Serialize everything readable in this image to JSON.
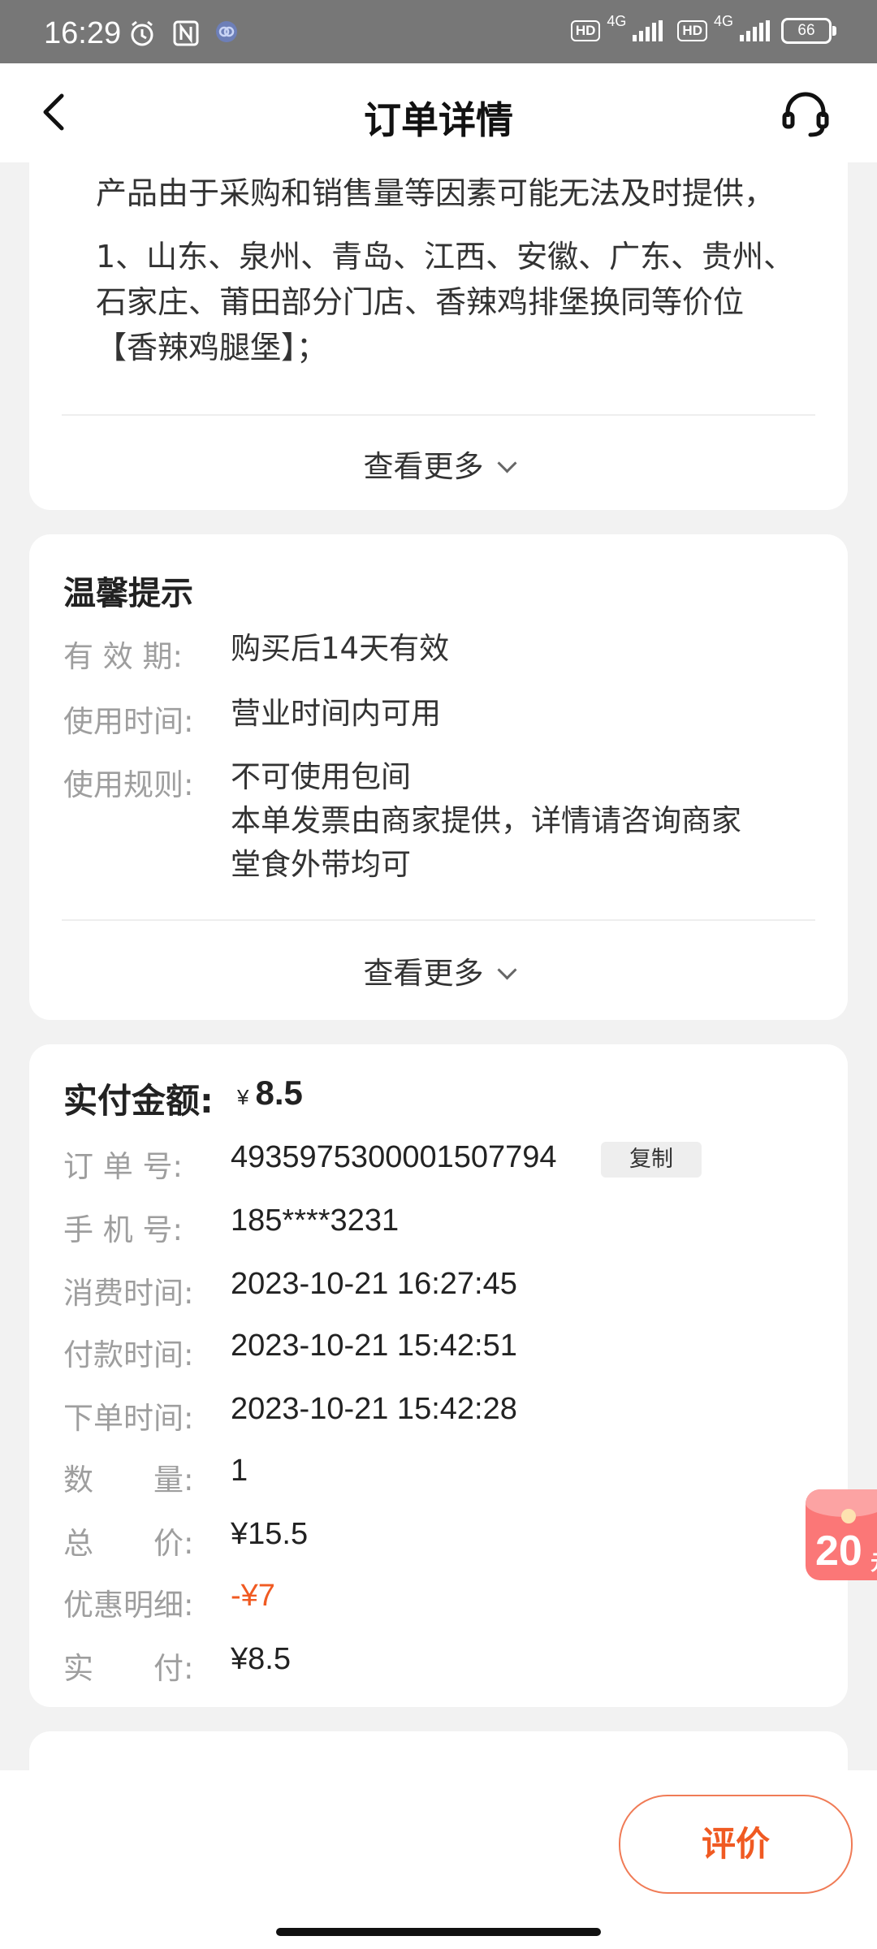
{
  "status_bar": {
    "time": "16:29",
    "hd1": "HD",
    "net1": "4G",
    "hd2": "HD",
    "net2": "4G",
    "battery": "66"
  },
  "header": {
    "title": "订单详情",
    "back_icon": "chevron-left-icon",
    "service_icon": "headset-icon"
  },
  "product_notes": {
    "line1": "产品由于采购和销售量等因素可能无法及时提供，",
    "line2": "1、山东、泉州、青岛、江西、安徽、广东、贵州、",
    "line3": "石家庄、莆田部分门店、香辣鸡排堡换同等价位",
    "line4": "【香辣鸡腿堡】；",
    "more_label": "查看更多"
  },
  "tips": {
    "title": "温馨提示",
    "validity_label": "有 效 期:",
    "validity_value": "购买后14天有效",
    "usage_time_label": "使用时间:",
    "usage_time_value": "营业时间内可用",
    "rules_label": "使用规则:",
    "rules": [
      "不可使用包间",
      "本单发票由商家提供，详情请咨询商家",
      "堂食外带均可"
    ],
    "more_label": "查看更多"
  },
  "order": {
    "paid_label": "实付金额:",
    "paid_currency": "¥",
    "paid_amount": "8.5",
    "order_no_label": "订 单 号:",
    "order_no": "4935975300001507794",
    "copy_label": "复制",
    "phone_label": "手 机 号:",
    "phone": "185****3231",
    "consume_time_label": "消费时间:",
    "consume_time": "2023-10-21 16:27:45",
    "pay_time_label": "付款时间:",
    "pay_time": "2023-10-21 15:42:51",
    "order_time_label": "下单时间:",
    "order_time": "2023-10-21 15:42:28",
    "qty_label": "数　　量:",
    "qty": "1",
    "total_label": "总　　价:",
    "total": "¥15.5",
    "discount_label": "优惠明细:",
    "discount": "-¥7",
    "actual_label": "实　　付:",
    "actual": "¥8.5"
  },
  "coupon": {
    "amount": "20",
    "unit": "元"
  },
  "bottom": {
    "review_label": "评价"
  },
  "colors": {
    "accent": "#f05a22",
    "background": "#f2f2f2",
    "status_bar": "#777777"
  }
}
